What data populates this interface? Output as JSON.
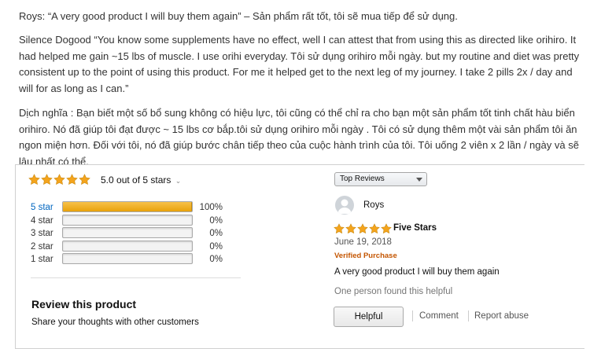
{
  "paragraphs": [
    "Roys: “A very good product I will buy them again” – Sản phẩm rất tốt, tôi sẽ mua tiếp để sử dụng.",
    "Silence Dogood “You know some supplements have no effect, well I can attest that from using this as directed like orihiro. It had helped me gain ~15 lbs of muscle. I use orihi everyday. Tôi sử dụng orihiro mỗi ngày. but my routine and diet was pretty consistent up to the point of using this product. For me it helped get to the next leg of my journey. I take 2 pills 2x / day and will for as long as I can.”",
    "Dịch nghĩa : Bạn biết một số bổ sung không có hiệu lực, tôi cũng có thể chỉ ra cho bạn một sản phẩm tốt tinh chất hàu biển orihiro. Nó đã giúp tôi đạt được ~ 15 lbs cơ bắp.tôi sử dụng orihiro mỗi ngày . Tôi có sử dụng thêm một vài sản phẩm tôi ăn ngon miện hơn.  Đối với tôi, nó đã giúp bước chân tiếp theo của cuộc hành trình của tôi. Tôi uống 2 viên x 2 lần / ngày và sẽ lâu nhất có thể."
  ],
  "summary": {
    "rating_text": "5.0 out of 5 stars",
    "rating_value": 5,
    "histogram": [
      {
        "label": "5 star",
        "percent": 100,
        "percent_text": "100%"
      },
      {
        "label": "4 star",
        "percent": 0,
        "percent_text": "0%"
      },
      {
        "label": "3 star",
        "percent": 0,
        "percent_text": "0%"
      },
      {
        "label": "2 star",
        "percent": 0,
        "percent_text": "0%"
      },
      {
        "label": "1 star",
        "percent": 0,
        "percent_text": "0%"
      }
    ],
    "review_heading": "Review this product",
    "review_sub": "Share your thoughts with other customers"
  },
  "sort": {
    "selected": "Top Reviews"
  },
  "review": {
    "author": "Roys",
    "rating_value": 5,
    "title": "Five Stars",
    "date": "June 19, 2018",
    "verified": "Verified Purchase",
    "body": "A very good product I will buy them again",
    "helpful_text": "One person found this helpful",
    "helpful_button": "Helpful",
    "comment_link": "Comment",
    "report_link": "Report abuse"
  },
  "colors": {
    "star": "#f4a41d",
    "link": "#0066c0",
    "verified": "#c45500",
    "bar_fill": "#f0b22a"
  },
  "icons": {
    "star": "star-icon",
    "avatar": "user-avatar-icon",
    "chevron": "chevron-down-icon"
  }
}
